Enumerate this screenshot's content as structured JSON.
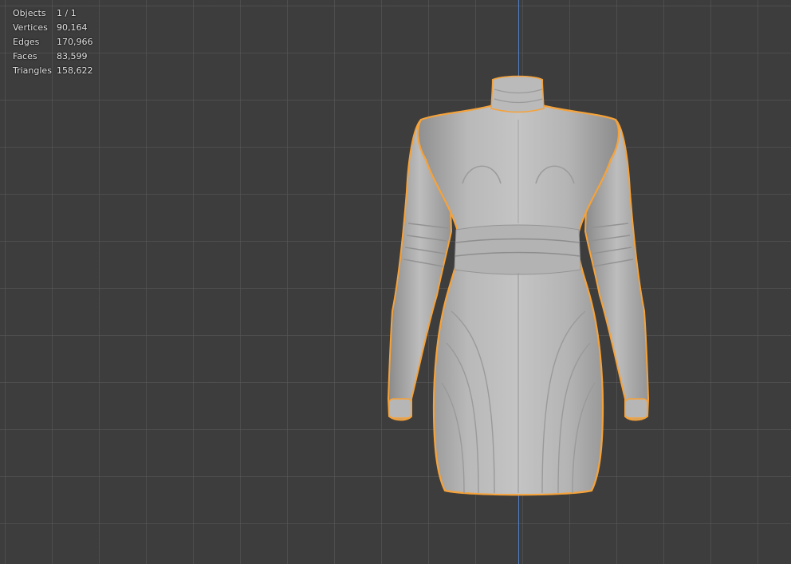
{
  "viewport": {
    "name": "3D Viewport",
    "accent_color": "#f5a23a",
    "grid_color": "#5a5a5a",
    "background_color": "#3d3d3d",
    "axis_z_color": "#4f7fc4"
  },
  "stats": [
    {
      "label": "Objects",
      "value": "1 / 1"
    },
    {
      "label": "Vertices",
      "value": "90,164"
    },
    {
      "label": "Edges",
      "value": "170,966"
    },
    {
      "label": "Faces",
      "value": "83,599"
    },
    {
      "label": "Triangles",
      "value": "158,622"
    }
  ]
}
